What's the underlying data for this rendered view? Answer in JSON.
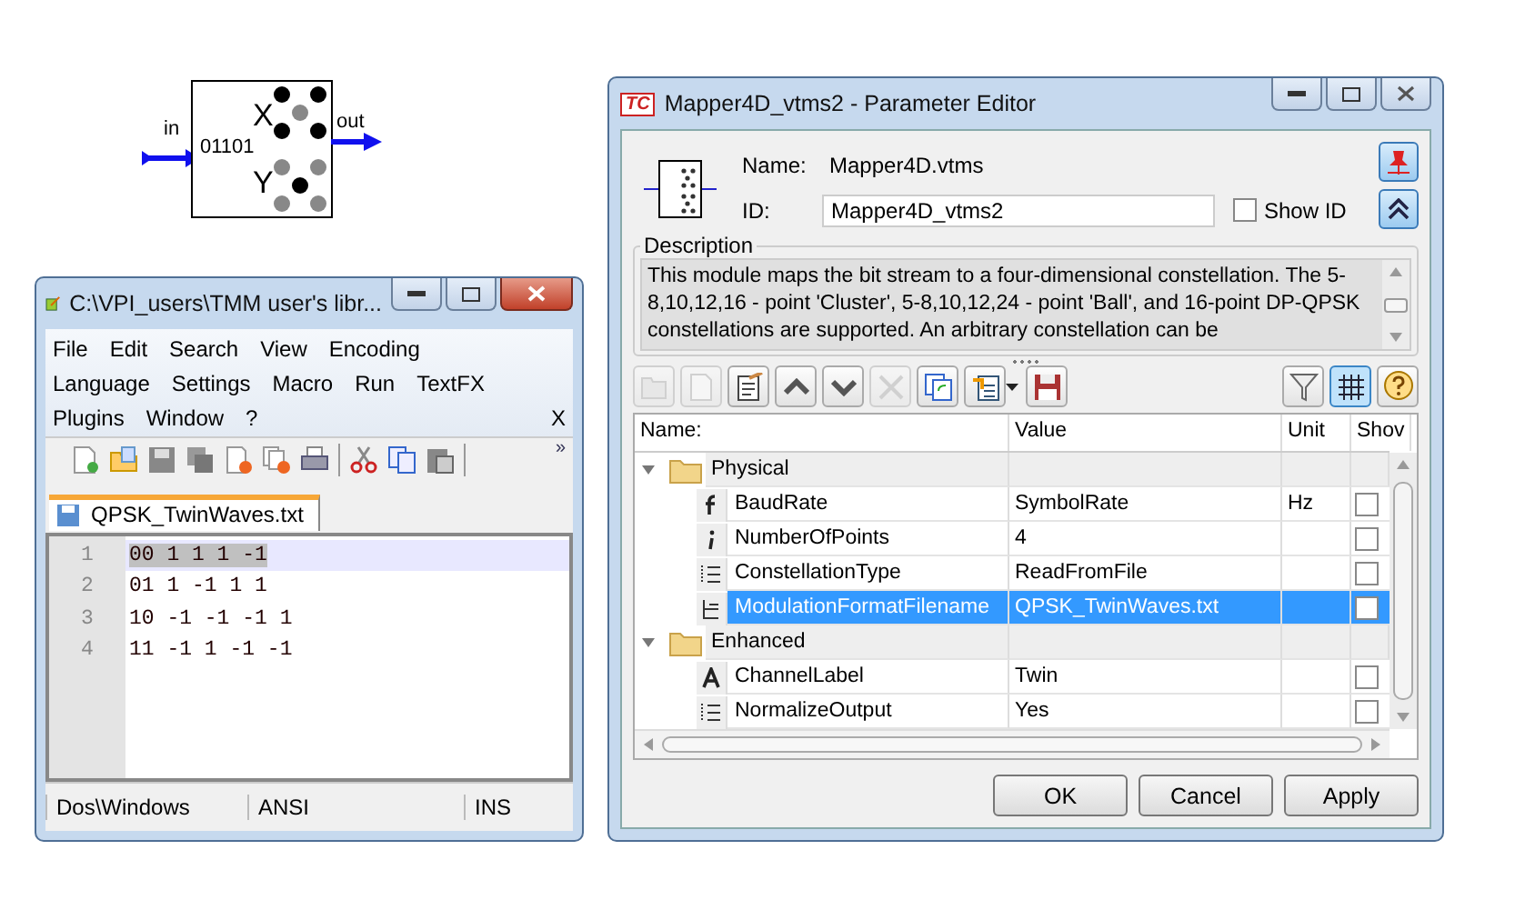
{
  "block": {
    "in_label": "in",
    "out_label": "out",
    "bits": "01101",
    "x_label": "X",
    "y_label": "Y"
  },
  "editor": {
    "title": "C:\\VPI_users\\TMM user's libr...",
    "menu_rows": [
      [
        "File",
        "Edit",
        "Search",
        "View",
        "Encoding"
      ],
      [
        "Language",
        "Settings",
        "Macro",
        "Run",
        "TextFX"
      ],
      [
        "Plugins",
        "Window",
        "?"
      ]
    ],
    "menu_close": "X",
    "overflow": "»",
    "tab": "QPSK_TwinWaves.txt",
    "lines": [
      {
        "number": "1",
        "text": "00 1 1 1 -1",
        "selected": true
      },
      {
        "number": "2",
        "text": "01 1 -1 1 1",
        "selected": false
      },
      {
        "number": "3",
        "text": "10 -1 -1 -1 1",
        "selected": false
      },
      {
        "number": "4",
        "text": "11 -1 1 -1 -1",
        "selected": false
      }
    ],
    "status": [
      "Dos\\Windows",
      "ANSI",
      "INS"
    ]
  },
  "param_editor": {
    "title": "Mapper4D_vtms2 - Parameter Editor",
    "logo": "TC",
    "name_label": "Name:",
    "name_value": "Mapper4D.vtms",
    "id_label": "ID:",
    "id_value": "Mapper4D_vtms2",
    "show_id": {
      "label": "Show ID",
      "checked": false
    },
    "description_label": "Description",
    "description": "This module maps the bit stream to a four-dimensional constellation. The 5-8,10,12,16 - point 'Cluster', 5-8,10,12,24 - point 'Ball', and 16-point DP-QPSK constellations are supported. An arbitrary constellation can be",
    "toolbar": [
      {
        "kind": "folder-add",
        "disabled": true,
        "pressed": false
      },
      {
        "kind": "page-add",
        "disabled": true,
        "pressed": false
      },
      {
        "kind": "notepad",
        "disabled": false,
        "pressed": false
      },
      {
        "kind": "up",
        "disabled": false,
        "pressed": false
      },
      {
        "kind": "down",
        "disabled": false,
        "pressed": false
      },
      {
        "kind": "delete",
        "disabled": true,
        "pressed": false
      },
      {
        "kind": "copy",
        "disabled": false,
        "pressed": false
      },
      {
        "kind": "list",
        "disabled": false,
        "pressed": false
      },
      {
        "kind": "save",
        "disabled": false,
        "pressed": false
      }
    ],
    "toolbar_right": [
      {
        "kind": "filter",
        "disabled": false,
        "pressed": false
      },
      {
        "kind": "grid",
        "disabled": false,
        "pressed": true
      },
      {
        "kind": "help",
        "disabled": false,
        "pressed": false
      }
    ],
    "columns": [
      "Name:",
      "Value",
      "Unit",
      "Shov"
    ],
    "groups": [
      {
        "name": "Physical",
        "expanded": true,
        "params": [
          {
            "kind": "float",
            "name": "BaudRate",
            "value": "SymbolRate",
            "unit": "Hz",
            "show": false,
            "selected": false
          },
          {
            "kind": "int",
            "name": "NumberOfPoints",
            "value": "4",
            "show": false,
            "selected": false
          },
          {
            "kind": "enum",
            "name": "ConstellationType",
            "value": "ReadFromFile",
            "show": false,
            "selected": false
          },
          {
            "kind": "file",
            "name": "ModulationFormatFilename",
            "value": "QPSK_TwinWaves.txt",
            "show": false,
            "selected": true
          }
        ]
      },
      {
        "name": "Enhanced",
        "expanded": true,
        "params": [
          {
            "kind": "string",
            "name": "ChannelLabel",
            "value": "Twin",
            "show": false,
            "selected": false
          },
          {
            "kind": "enum",
            "name": "NormalizeOutput",
            "value": "Yes",
            "show": false,
            "selected": false
          }
        ]
      }
    ],
    "buttons": [
      "OK",
      "Cancel",
      "Apply"
    ]
  }
}
